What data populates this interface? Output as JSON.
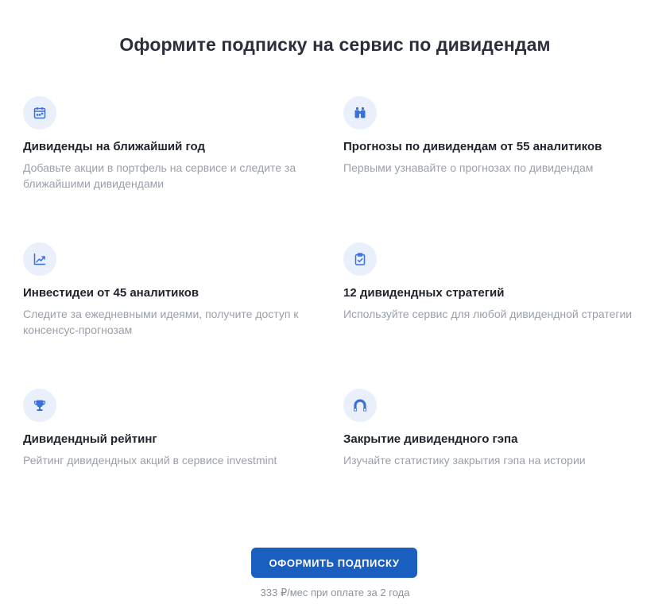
{
  "header": {
    "title": "Оформите подписку на сервис по дивидендам"
  },
  "features": [
    {
      "icon": "calendar-icon",
      "title": "Дивиденды на ближайший год",
      "description": "Добавьте акции в портфель на сервисе и следите за ближайшими дивидендами"
    },
    {
      "icon": "binoculars-icon",
      "title": "Прогнозы по дивидендам от 55 аналитиков",
      "description": "Первыми узнавайте о прогнозах по дивидендам"
    },
    {
      "icon": "chart-trend-icon",
      "title": "Инвестидеи от 45 аналитиков",
      "description": "Следите за ежедневными идеями, получите доступ к консенсус-прогнозам"
    },
    {
      "icon": "clipboard-check-icon",
      "title": "12 дивидендных стратегий",
      "description": "Используйте сервис для любой дивидендной стратегии"
    },
    {
      "icon": "trophy-icon",
      "title": "Дивидендный рейтинг",
      "description": "Рейтинг дивидендных акций в сервисе investmint"
    },
    {
      "icon": "magnet-icon",
      "title": "Закрытие дивидендного гэпа",
      "description": "Изучайте статистику закрытия гэпа на истории"
    }
  ],
  "cta": {
    "button_label": "ОФОРМИТЬ ПОДПИСКУ",
    "price_note": "333 ₽/мес при оплате за 2 года"
  },
  "colors": {
    "accent": "#1a5fbf",
    "icon_background": "#eaf0fb",
    "icon_color": "#3b6fd9",
    "muted_text": "#9aa0aa"
  }
}
